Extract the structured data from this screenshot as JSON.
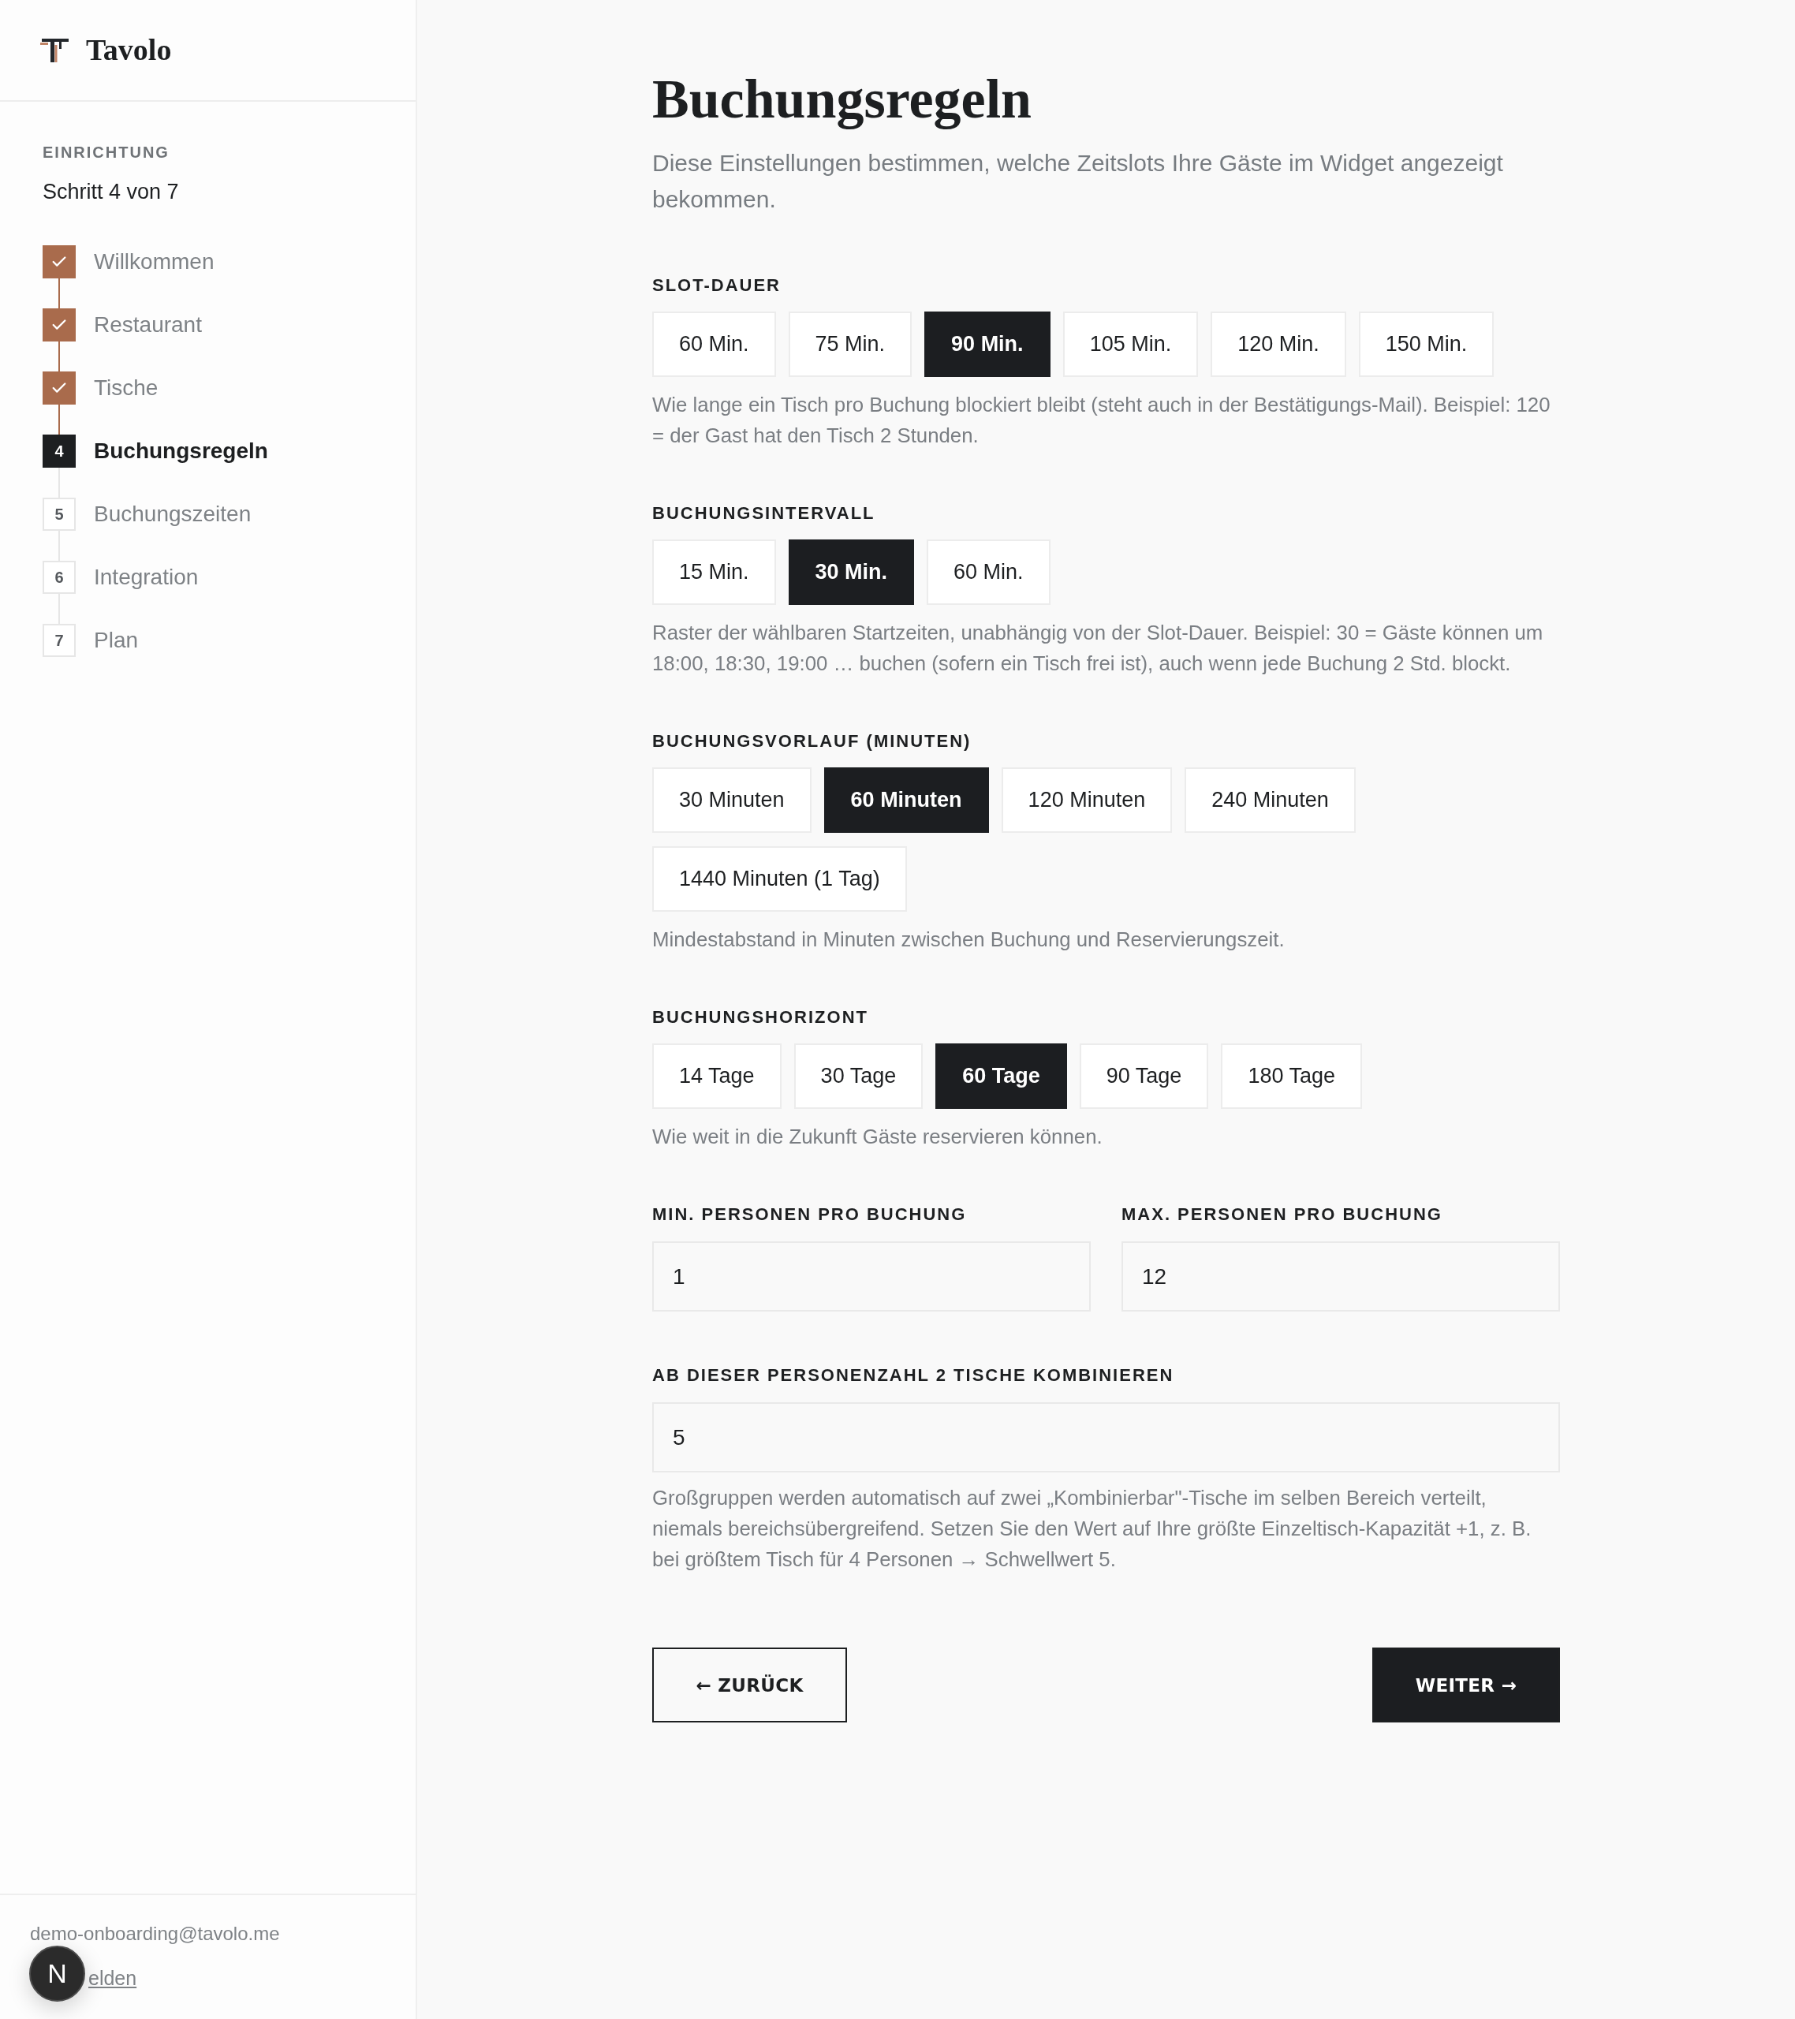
{
  "sidebar": {
    "brand": "Tavolo",
    "section_label": "EINRICHTUNG",
    "progress": "Schritt 4 von 7",
    "steps": [
      {
        "label": "Willkommen",
        "completed": true,
        "selected": false
      },
      {
        "label": "Restaurant",
        "completed": true,
        "selected": false
      },
      {
        "label": "Tische",
        "completed": true,
        "selected": false
      },
      {
        "number": "4",
        "label": "Buchungsregeln",
        "completed": false,
        "selected": true
      },
      {
        "number": "5",
        "label": "Buchungszeiten",
        "completed": false,
        "selected": false
      },
      {
        "number": "6",
        "label": "Integration",
        "completed": false,
        "selected": false
      },
      {
        "number": "7",
        "label": "Plan",
        "completed": false,
        "selected": false
      }
    ],
    "account": {
      "email": "demo-onboarding@tavolo.me",
      "logout": "elden"
    }
  },
  "dev_badge": {
    "label": "N"
  },
  "page": {
    "title": "Buchungsregeln",
    "description": "Diese Einstellungen bestimmen, welche Zeitslots Ihre Gäste im Widget angezeigt bekommen."
  },
  "option_groups": [
    {
      "label": "SLOT-DAUER",
      "options": [
        {
          "label": "60 Min.",
          "selected": false
        },
        {
          "label": "75 Min.",
          "selected": false
        },
        {
          "label": "90 Min.",
          "selected": true
        },
        {
          "label": "105 Min.",
          "selected": false
        },
        {
          "label": "120 Min.",
          "selected": false
        },
        {
          "label": "150 Min.",
          "selected": false
        }
      ],
      "help": "Wie lange ein Tisch pro Buchung blockiert bleibt (steht auch in der Bestätigungs-Mail). Beispiel: 120 = der Gast hat den Tisch 2 Stunden."
    },
    {
      "label": "BUCHUNGSINTERVALL",
      "options": [
        {
          "label": "15 Min.",
          "selected": false
        },
        {
          "label": "30 Min.",
          "selected": true
        },
        {
          "label": "60 Min.",
          "selected": false
        }
      ],
      "help": "Raster der wählbaren Startzeiten, unabhängig von der Slot-Dauer. Beispiel: 30 = Gäste können um 18:00, 18:30, 19:00 … buchen (sofern ein Tisch frei ist), auch wenn jede Buchung 2 Std. blockt."
    },
    {
      "label": "BUCHUNGSVORLAUF (MINUTEN)",
      "options": [
        {
          "label": "30 Minuten",
          "selected": false
        },
        {
          "label": "60 Minuten",
          "selected": true
        },
        {
          "label": "120 Minuten",
          "selected": false
        },
        {
          "label": "240 Minuten",
          "selected": false
        },
        {
          "label": "1440 Minuten (1 Tag)",
          "selected": false
        }
      ],
      "help": "Mindestabstand in Minuten zwischen Buchung und Reservierungszeit."
    },
    {
      "label": "BUCHUNGSHORIZONT",
      "options": [
        {
          "label": "14 Tage",
          "selected": false
        },
        {
          "label": "30 Tage",
          "selected": false
        },
        {
          "label": "60 Tage",
          "selected": true
        },
        {
          "label": "90 Tage",
          "selected": false
        },
        {
          "label": "180 Tage",
          "selected": false
        }
      ],
      "help": "Wie weit in die Zukunft Gäste reservieren können."
    }
  ],
  "person_fields": [
    {
      "label": "MIN. PERSONEN PRO BUCHUNG",
      "value": "1"
    },
    {
      "label": "MAX. PERSONEN PRO BUCHUNG",
      "value": "12"
    }
  ],
  "combine_field": {
    "label": "AB DIESER PERSONENZAHL 2 TISCHE KOMBINIEREN",
    "value": "5",
    "help": "Großgruppen werden automatisch auf zwei „Kombinierbar\"-Tische im selben Bereich verteilt, niemals bereichsübergreifend. Setzen Sie den Wert auf Ihre größte Einzeltisch-Kapazität +1, z. B. bei größtem Tisch für 4 Personen → Schwellwert 5."
  },
  "actions": {
    "back": "← ZURÜCK",
    "next": "WEITER →"
  }
}
